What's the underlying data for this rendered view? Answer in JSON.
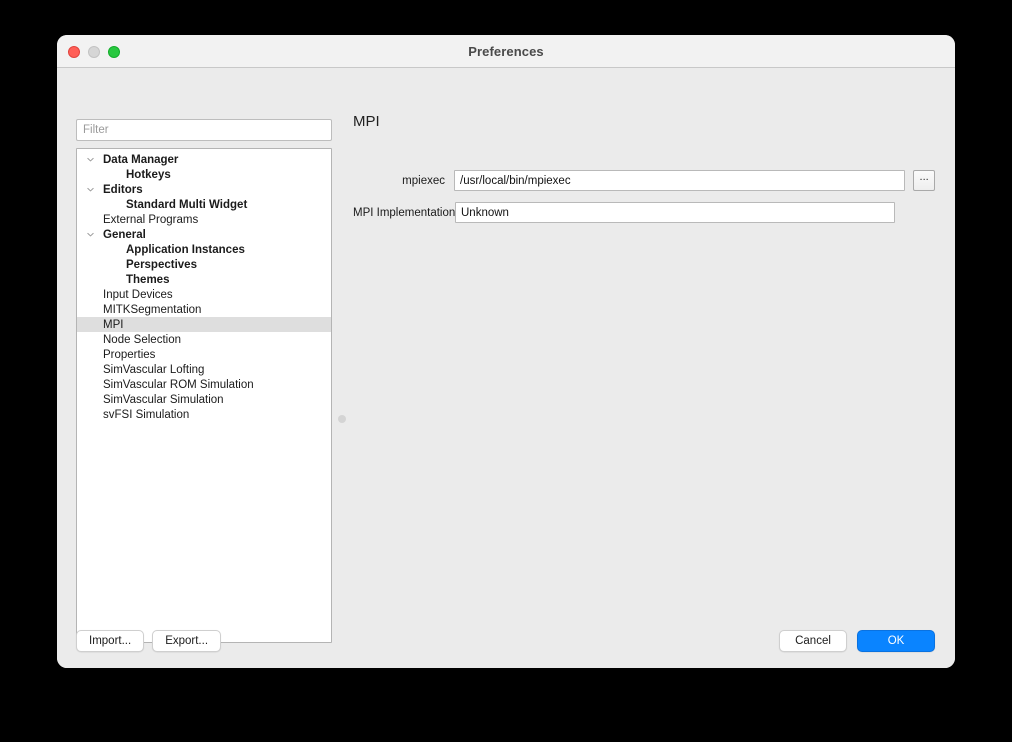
{
  "window": {
    "title": "Preferences",
    "traffic_lights": [
      {
        "name": "close",
        "color": "#ff5f57"
      },
      {
        "name": "minimize",
        "color": "#d6d6d6"
      },
      {
        "name": "zoom",
        "color": "#28c840"
      }
    ]
  },
  "sidebar": {
    "filter": {
      "value": "",
      "placeholder": "Filter"
    },
    "items": [
      {
        "label": "Data Manager",
        "level": 0,
        "expandable": true,
        "expanded": true,
        "selected": false
      },
      {
        "label": "Hotkeys",
        "level": 1,
        "expandable": false,
        "expanded": false,
        "selected": false
      },
      {
        "label": "Editors",
        "level": 0,
        "expandable": true,
        "expanded": true,
        "selected": false
      },
      {
        "label": "Standard Multi Widget",
        "level": 1,
        "expandable": false,
        "expanded": false,
        "selected": false
      },
      {
        "label": "External Programs",
        "level": 0,
        "expandable": false,
        "expanded": false,
        "selected": false
      },
      {
        "label": "General",
        "level": 0,
        "expandable": true,
        "expanded": true,
        "selected": false
      },
      {
        "label": "Application Instances",
        "level": 1,
        "expandable": false,
        "expanded": false,
        "selected": false
      },
      {
        "label": "Perspectives",
        "level": 1,
        "expandable": false,
        "expanded": false,
        "selected": false
      },
      {
        "label": "Themes",
        "level": 1,
        "expandable": false,
        "expanded": false,
        "selected": false
      },
      {
        "label": "Input Devices",
        "level": 0,
        "expandable": false,
        "expanded": false,
        "selected": false
      },
      {
        "label": "MITKSegmentation",
        "level": 0,
        "expandable": false,
        "expanded": false,
        "selected": false
      },
      {
        "label": "MPI",
        "level": 0,
        "expandable": false,
        "expanded": false,
        "selected": true
      },
      {
        "label": "Node Selection",
        "level": 0,
        "expandable": false,
        "expanded": false,
        "selected": false
      },
      {
        "label": "Properties",
        "level": 0,
        "expandable": false,
        "expanded": false,
        "selected": false
      },
      {
        "label": "SimVascular Lofting",
        "level": 0,
        "expandable": false,
        "expanded": false,
        "selected": false
      },
      {
        "label": "SimVascular ROM Simulation",
        "level": 0,
        "expandable": false,
        "expanded": false,
        "selected": false
      },
      {
        "label": "SimVascular Simulation",
        "level": 0,
        "expandable": false,
        "expanded": false,
        "selected": false
      },
      {
        "label": "svFSI Simulation",
        "level": 0,
        "expandable": false,
        "expanded": false,
        "selected": false
      }
    ]
  },
  "main": {
    "page_title": "MPI",
    "fields": {
      "mpiexec": {
        "label": "mpiexec",
        "value": "/usr/local/bin/mpiexec",
        "placeholder": ""
      },
      "mpi_implementation": {
        "label": "MPI Implementation",
        "value": "Unknown",
        "placeholder": ""
      }
    },
    "browse_button_label": "..."
  },
  "footer": {
    "import_label": "Import...",
    "export_label": "Export...",
    "cancel_label": "Cancel",
    "ok_label": "OK"
  },
  "colors": {
    "accent": "#0a84ff",
    "window_bg": "#ebebeb",
    "titlebar_bg": "#f2f2f2",
    "selection_bg": "#dedede"
  }
}
